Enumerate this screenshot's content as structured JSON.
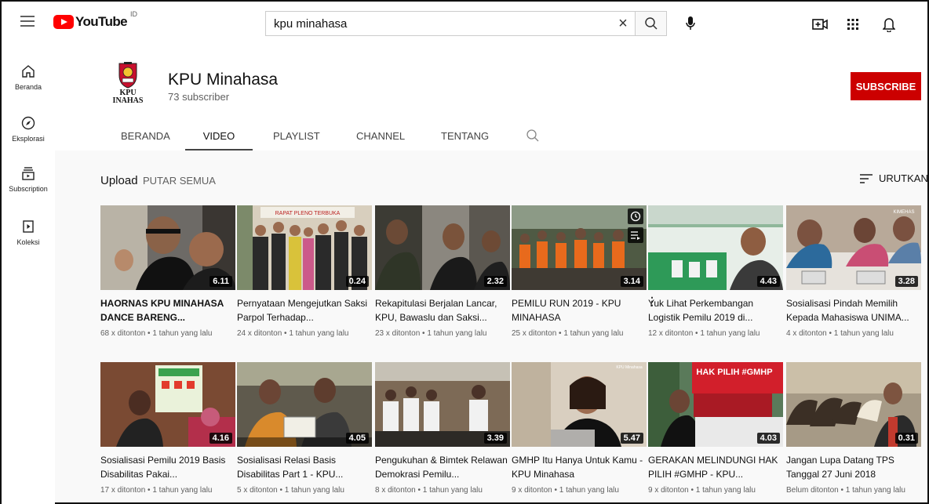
{
  "header": {
    "logo_text": "YouTube",
    "country_code": "ID",
    "search_value": "kpu minahasa",
    "clear_symbol": "×"
  },
  "sidebar": {
    "items": [
      {
        "label": "Beranda",
        "icon": "home-icon"
      },
      {
        "label": "Eksplorasi",
        "icon": "compass-icon"
      },
      {
        "label": "Subscription",
        "icon": "subscriptions-icon"
      },
      {
        "label": "Koleksi",
        "icon": "library-icon"
      }
    ]
  },
  "channel": {
    "name": "KPU Minahasa",
    "subscribers": "73 subscriber",
    "subscribe_label": "SUBSCRIBE",
    "avatar_line1": "KPU",
    "avatar_line2": "INAHAS",
    "tabs": [
      "BERANDA",
      "VIDEO",
      "PLAYLIST",
      "CHANNEL",
      "TENTANG"
    ],
    "active_tab": "VIDEO"
  },
  "section": {
    "title": "Upload",
    "play_all": "PUTAR SEMUA",
    "sort_label": "URUTKAN"
  },
  "videos": [
    {
      "title": "HAORNAS KPU MINAHASA DANCE BARENG...",
      "duration": "6.11",
      "meta": "68 x ditonton • 1 tahun yang lalu",
      "bold": true
    },
    {
      "title": "Pernyataan Mengejutkan Saksi Parpol Terhadap...",
      "duration": "0.24",
      "meta": "24 x ditonton • 1 tahun yang lalu"
    },
    {
      "title": "Rekapitulasi Berjalan Lancar, KPU, Bawaslu dan Saksi...",
      "duration": "2.32",
      "meta": "23 x ditonton • 1 tahun yang lalu"
    },
    {
      "title": "PEMILU RUN 2019 - KPU MINAHASA",
      "duration": "3.14",
      "meta": "25 x ditonton • 1 tahun yang lalu"
    },
    {
      "title": "Yuk Lihat Perkembangan Logistik Pemilu 2019 di...",
      "duration": "4.43",
      "meta": "12 x ditonton • 1 tahun yang lalu"
    },
    {
      "title": "Sosialisasi Pindah Memilih Kepada Mahasiswa UNIMA...",
      "duration": "3.28",
      "meta": "4 x ditonton • 1 tahun yang lalu"
    },
    {
      "title": "Sosialisasi Pemilu 2019 Basis Disabilitas Pakai...",
      "duration": "4.16",
      "meta": "17 x ditonton • 1 tahun yang lalu"
    },
    {
      "title": "Sosialisasi Relasi Basis Disabilitas Part 1 - KPU...",
      "duration": "4.05",
      "meta": "5 x ditonton • 1 tahun yang lalu"
    },
    {
      "title": "Pengukuhan & Bimtek Relawan Demokrasi Pemilu...",
      "duration": "3.39",
      "meta": "8 x ditonton • 1 tahun yang lalu"
    },
    {
      "title": "GMHP Itu Hanya Untuk Kamu - KPU Minahasa",
      "duration": "5.47",
      "meta": "9 x ditonton • 1 tahun yang lalu"
    },
    {
      "title": "GERAKAN MELINDUNGI HAK PILIH #GMHP - KPU...",
      "duration": "4.03",
      "meta": "9 x ditonton • 1 tahun yang lalu"
    },
    {
      "title": "Jangan Lupa Datang TPS Tanggal 27 Juni 2018",
      "duration": "0.31",
      "meta": "Belum ditonton • 1 tahun yang lalu"
    }
  ],
  "thumb_text": {
    "v2_banner": "RAPAT PLENO TERBUKA",
    "v10_brand": "KPU Minahasa",
    "v11_banner": "HAK PILIH #GMHP",
    "v6_brand": "KIMEHAS"
  },
  "colors": {
    "brand_red": "#ff0000",
    "subscribe_red": "#cc0000",
    "page_bg": "#f9f9f9"
  }
}
